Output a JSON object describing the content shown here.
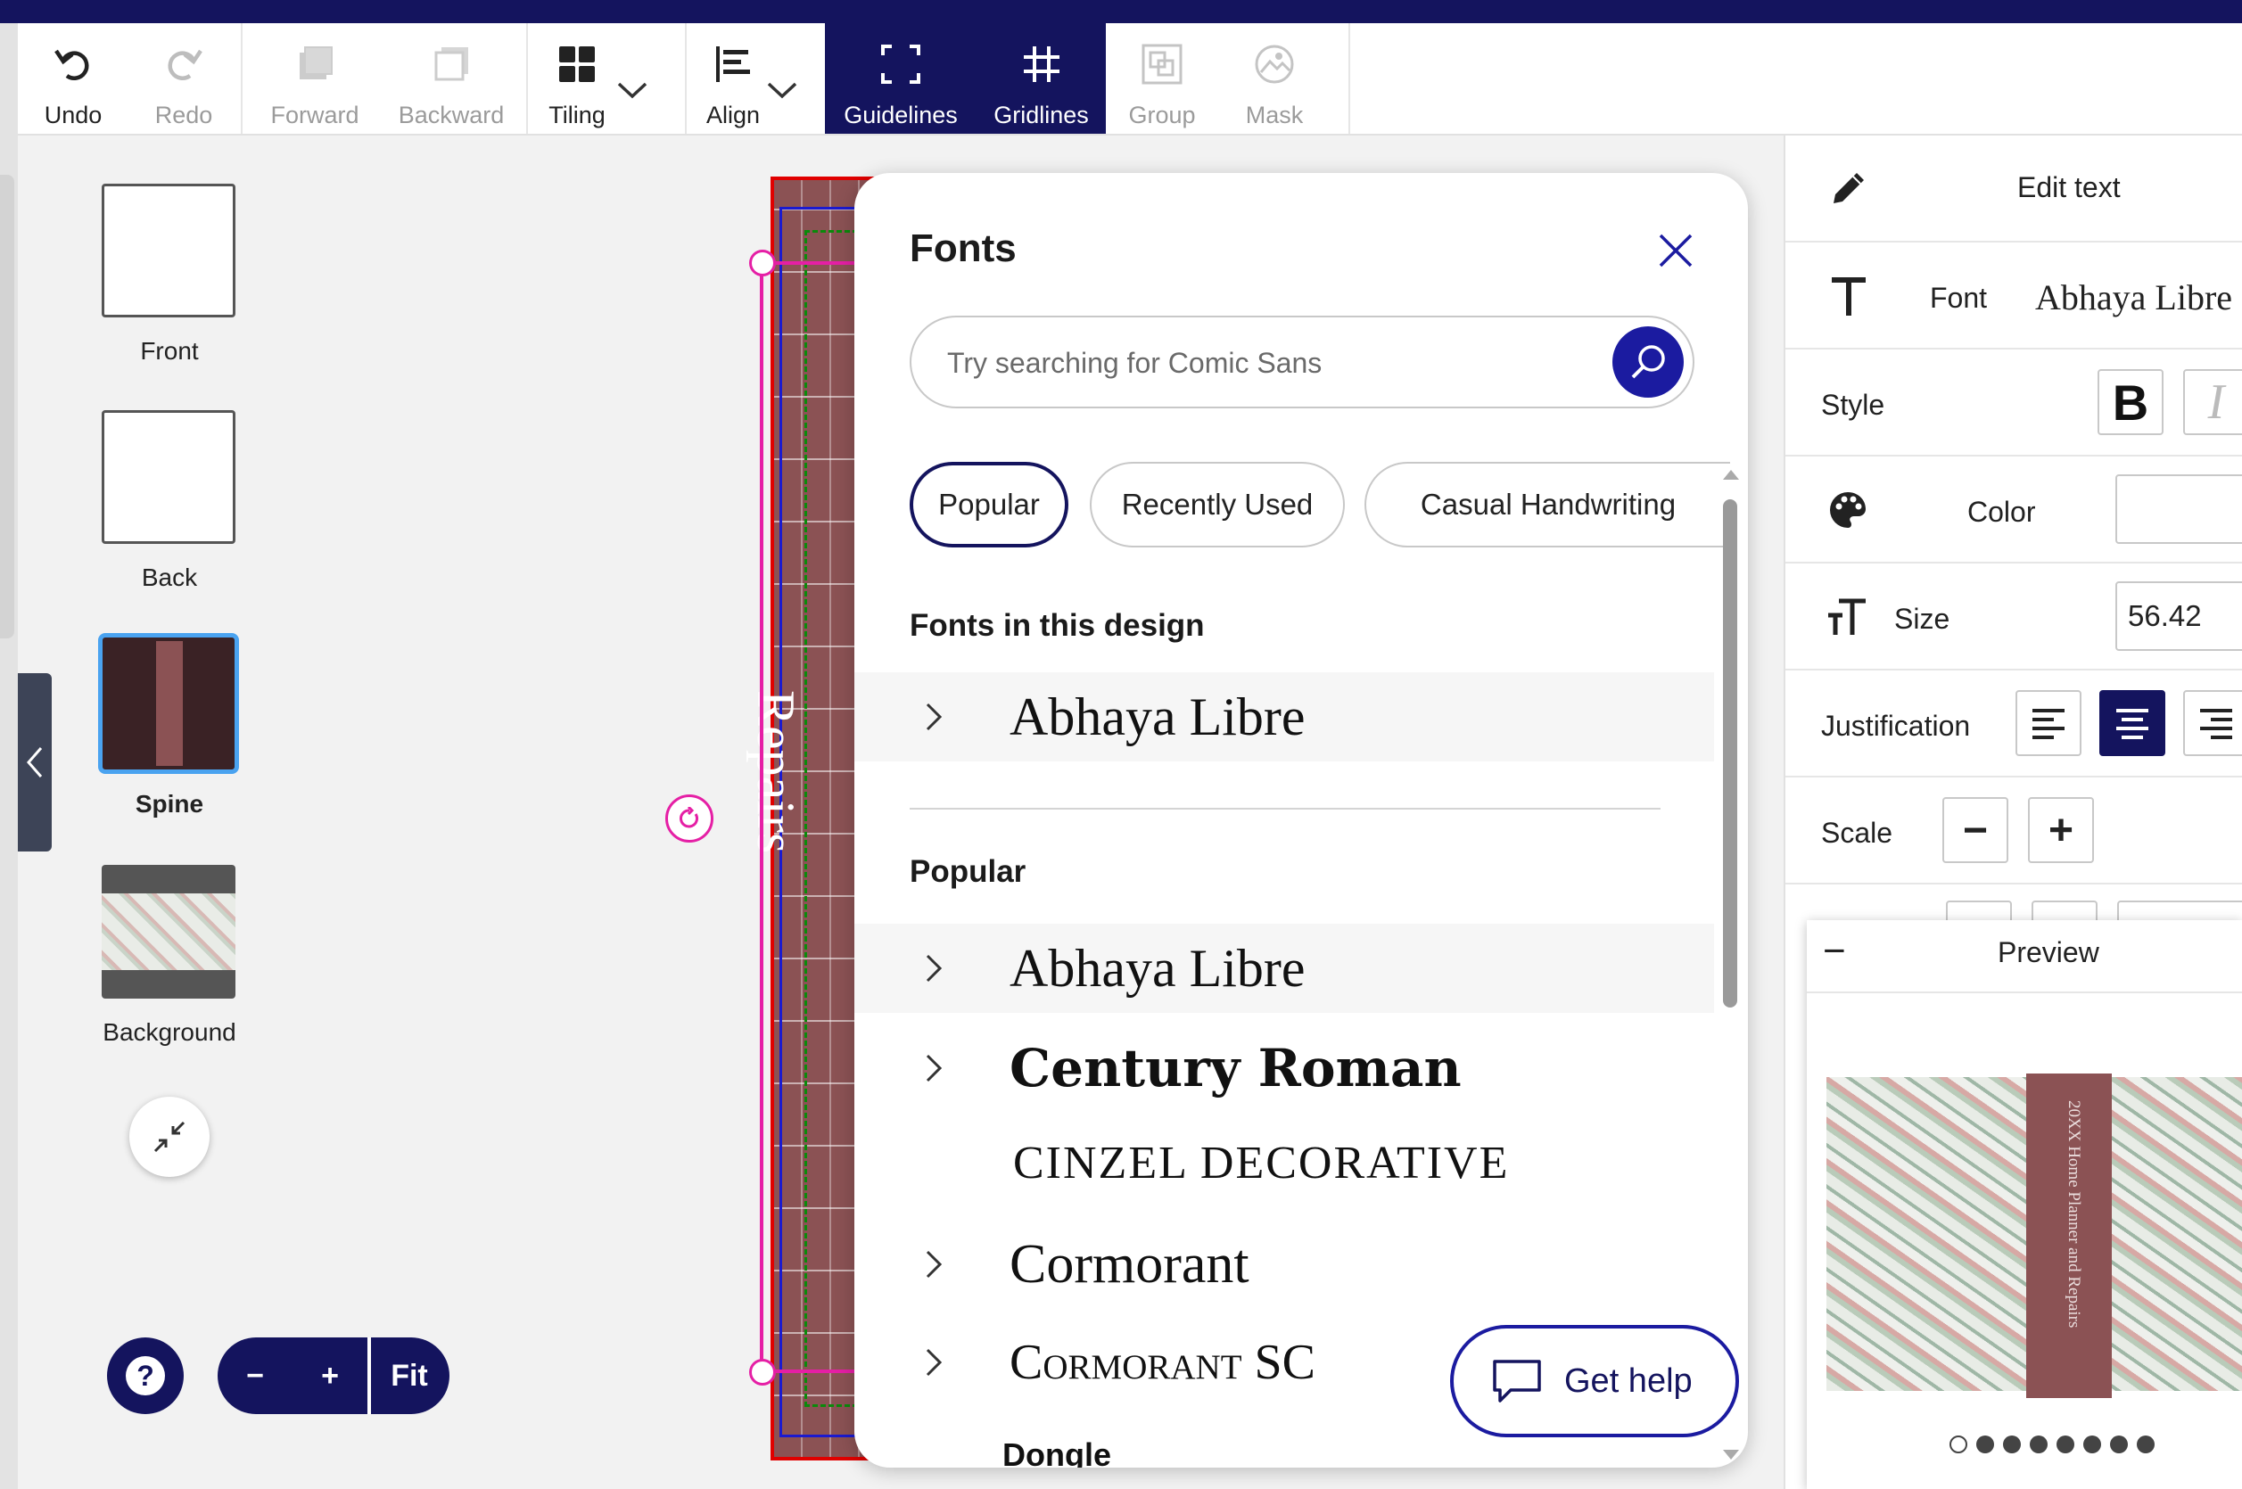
{
  "toolbar": {
    "undo": "Undo",
    "redo": "Redo",
    "forward": "Forward",
    "backward": "Backward",
    "tiling": "Tiling",
    "align": "Align",
    "guidelines": "Guidelines",
    "gridlines": "Gridlines",
    "group": "Group",
    "mask": "Mask"
  },
  "pages": [
    {
      "label": "Front"
    },
    {
      "label": "Back"
    },
    {
      "label": "Spine"
    },
    {
      "label": "Background"
    }
  ],
  "canvas": {
    "spine_text": "Repairs"
  },
  "zoom": {
    "minus": "−",
    "plus": "+",
    "fit": "Fit"
  },
  "help_symbol": "?",
  "fonts_panel": {
    "title": "Fonts",
    "search_placeholder": "Try searching for Comic Sans",
    "chips": [
      "Popular",
      "Recently Used",
      "Casual Handwriting"
    ],
    "section_in_design": "Fonts in this design",
    "design_fonts": [
      "Abhaya Libre"
    ],
    "section_popular": "Popular",
    "popular_fonts": [
      "Abhaya Libre",
      "Century Roman",
      "CINZEL DECORATIVE",
      "Cormorant",
      "Cormorant SC",
      "Dongle"
    ]
  },
  "get_help": "Get help",
  "edit_panel": {
    "header": "Edit text",
    "font_label": "Font",
    "font_value": "Abhaya Libre",
    "style_label": "Style",
    "bold": "B",
    "italic": "I",
    "color_label": "Color",
    "size_label": "Size",
    "size_value": "56.42",
    "justification_label": "Justification",
    "scale_label": "Scale",
    "scale_minus": "−",
    "scale_plus": "+"
  },
  "preview": {
    "title": "Preview",
    "collapse": "−",
    "book_spine_text": "20XX Home Planner and Repairs",
    "page_count": 8,
    "active_page": 1
  },
  "colors": {
    "brand_navy": "#14145e",
    "accent_blue": "#1b1ba0",
    "spine_red": "#8b5254",
    "selection_pink": "#e51fa5"
  }
}
